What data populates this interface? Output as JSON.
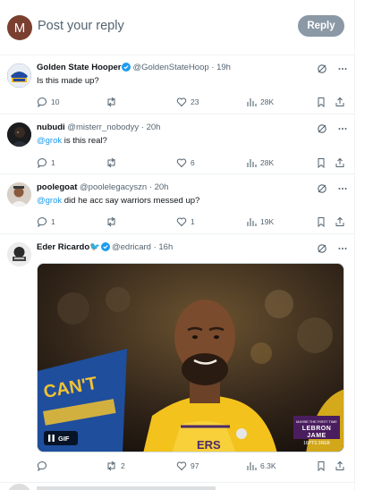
{
  "composer": {
    "avatar_letter": "M",
    "avatar_color": "#7b3f2f",
    "placeholder": "Post your reply",
    "reply_label": "Reply"
  },
  "tweets": [
    {
      "name": "Golden State Hooper",
      "verified": true,
      "handle": "@GoldenStateHoop",
      "time": "· 19h",
      "text": "Is this made up?",
      "replies": "10",
      "reposts": "",
      "likes": "23",
      "views": "28K"
    },
    {
      "name": "nubudi",
      "verified": false,
      "handle": "@misterr_nobodyy",
      "time": "· 20h",
      "mention": "@grok",
      "text": " is this real?",
      "replies": "1",
      "reposts": "",
      "likes": "6",
      "views": "28K"
    },
    {
      "name": "poolegoat",
      "verified": false,
      "handle": "@poolelegacyszn",
      "time": "· 20h",
      "mention": "@grok",
      "text": " did he acc say warriors messed up?",
      "replies": "1",
      "reposts": "",
      "likes": "1",
      "views": "19K"
    },
    {
      "name": "Eder Ricardo",
      "name_emoji": "🐦",
      "verified": true,
      "handle": "@edricard",
      "time": "· 16h",
      "media": {
        "gif_label": "GIF",
        "court_text": "CAN'T",
        "watermark_small": "MAYBE THE FIRST TIME",
        "watermark_big": "LEBRON JAME",
        "watermark_sub": "16PTS 3REB"
      },
      "replies": "",
      "reposts": "2",
      "likes": "97",
      "views": "6.3K"
    }
  ],
  "colors": {
    "accent": "#1d9bf0",
    "muted": "#536471",
    "divider": "#eff3f4",
    "reply_button": "#8b98a5"
  }
}
